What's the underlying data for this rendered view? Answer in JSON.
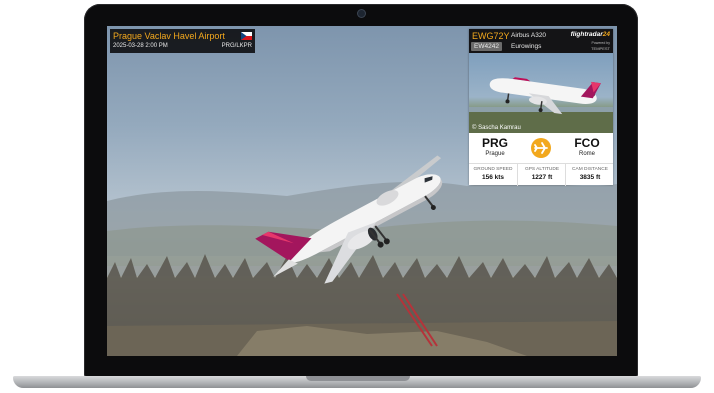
{
  "airport": {
    "name": "Prague Vaclav Havel Airport",
    "datetime": "2025-03-28  2:00 PM",
    "codes": "PRG/LKPR"
  },
  "flight": {
    "callsign": "EWG72Y",
    "flight_number": "EW4242",
    "aircraft": "Airbus A320",
    "airline": "Eurowings",
    "brand": "flightradar",
    "brand_num": "24",
    "powered_label": "Powered by",
    "powered_by": "TEMPEST",
    "photo_credit": "© Sascha Kamrau",
    "origin": {
      "code": "PRG",
      "city": "Prague"
    },
    "destination": {
      "code": "FCO",
      "city": "Rome"
    },
    "stats": [
      {
        "label": "GROUND SPEED",
        "value": "156 kts"
      },
      {
        "label": "GPS ALTITUDE",
        "value": "1227 ft"
      },
      {
        "label": "CAM DISTANCE",
        "value": "3835 ft"
      }
    ]
  },
  "colors": {
    "accent": "#f2a81d",
    "overlay_bg": "#141416",
    "livery_magenta": "#a3165d"
  },
  "icons": [
    "webcam-icon",
    "czech-flag-icon",
    "plane-icon"
  ]
}
